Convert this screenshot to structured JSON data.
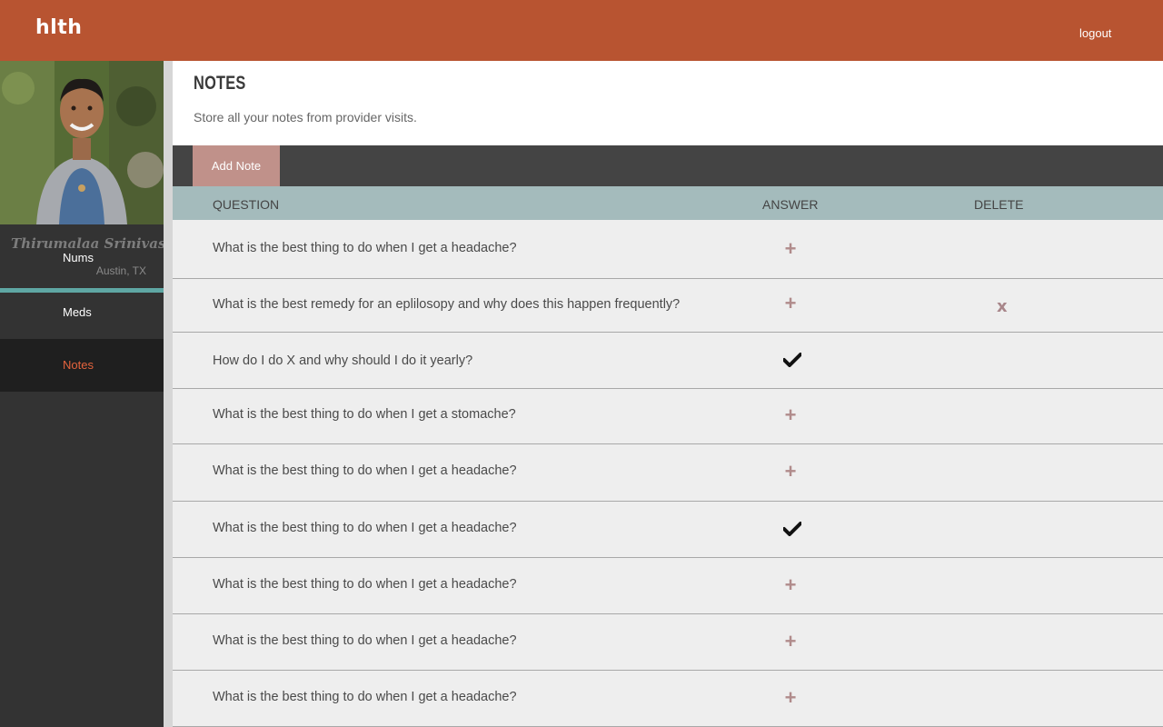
{
  "app": {
    "brand": "hlth",
    "logout_label": "logout"
  },
  "user": {
    "name": "Thirumalaa Srinivas",
    "location": "Austin, TX"
  },
  "sidebar": {
    "items": [
      {
        "label": "Nums",
        "active": false
      },
      {
        "label": "Meds",
        "active": false
      },
      {
        "label": "Notes",
        "active": true
      }
    ]
  },
  "page": {
    "title": "NOTES",
    "subtitle": "Store all your notes from provider visits."
  },
  "toolbar": {
    "add_note_label": "Add Note"
  },
  "table": {
    "headers": {
      "question": "QUESTION",
      "answer": "ANSWER",
      "delete": "DELETE"
    },
    "rows": [
      {
        "question": "What is the best thing to do when I get a headache?",
        "answer_icon": "plus-icon",
        "delete": ""
      },
      {
        "question": "What is the best remedy for an eplilosopy and why does this happen frequently?",
        "answer_icon": "plus-icon",
        "delete": "x"
      },
      {
        "question": "How do I do X and why should I do it yearly?",
        "answer_icon": "check-icon",
        "delete": ""
      },
      {
        "question": "What is the best thing to do when I get a stomache?",
        "answer_icon": "plus-icon",
        "delete": ""
      },
      {
        "question": "What is the best thing to do when I get a headache?",
        "answer_icon": "plus-icon",
        "delete": ""
      },
      {
        "question": "What is the best thing to do when I get a headache?",
        "answer_icon": "check-icon",
        "delete": ""
      },
      {
        "question": "What is the best thing to do when I get a headache?",
        "answer_icon": "plus-icon",
        "delete": ""
      },
      {
        "question": "What is the best thing to do when I get a headache?",
        "answer_icon": "plus-icon",
        "delete": ""
      },
      {
        "question": "What is the best thing to do when I get a headache?",
        "answer_icon": "plus-icon",
        "delete": ""
      }
    ]
  },
  "colors": {
    "topbar": "#b85431",
    "active_nav_text": "#e4633d",
    "accent_rule": "#5fa7a4",
    "add_note_button": "#c0918a",
    "table_header": "#a4bbbc"
  }
}
